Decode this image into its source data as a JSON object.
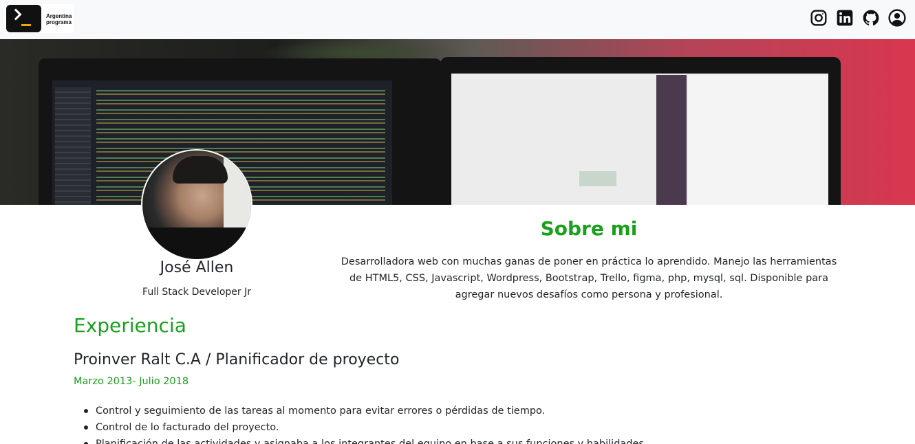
{
  "navbar": {
    "brand_line1": "Argentina",
    "brand_line2": "programa",
    "social_icons": [
      "instagram-icon",
      "linkedin-icon",
      "github-icon",
      "user-icon"
    ]
  },
  "profile": {
    "name": "José Allen",
    "role": "Full Stack Developer Jr"
  },
  "about": {
    "title": "Sobre mi",
    "text": "Desarrolladora web con muchas ganas de poner en práctica lo aprendido. Manejo las herramientas de HTML5, CSS, Javascript, Wordpress, Bootstrap, Trello, figma, php, mysql, sql. Disponible para agregar nuevos desafíos como persona y profesional."
  },
  "experience": {
    "title": "Experiencia",
    "jobs": [
      {
        "title": "Proinver Ralt C.A / Planificador de proyecto",
        "dates": "Marzo 2013- Julio 2018",
        "tasks": [
          "Control y seguimiento de las tareas al momento para evitar errores o pérdidas de tiempo.",
          "Control de lo facturado del proyecto.",
          "Planificación de las actividades y asignaba a los integrantes del equipo en base a sus funciones y habilidades."
        ]
      }
    ]
  },
  "colors": {
    "accent_green": "#19a01c",
    "navbar_bg": "#f8f9fa",
    "text": "#212529"
  }
}
